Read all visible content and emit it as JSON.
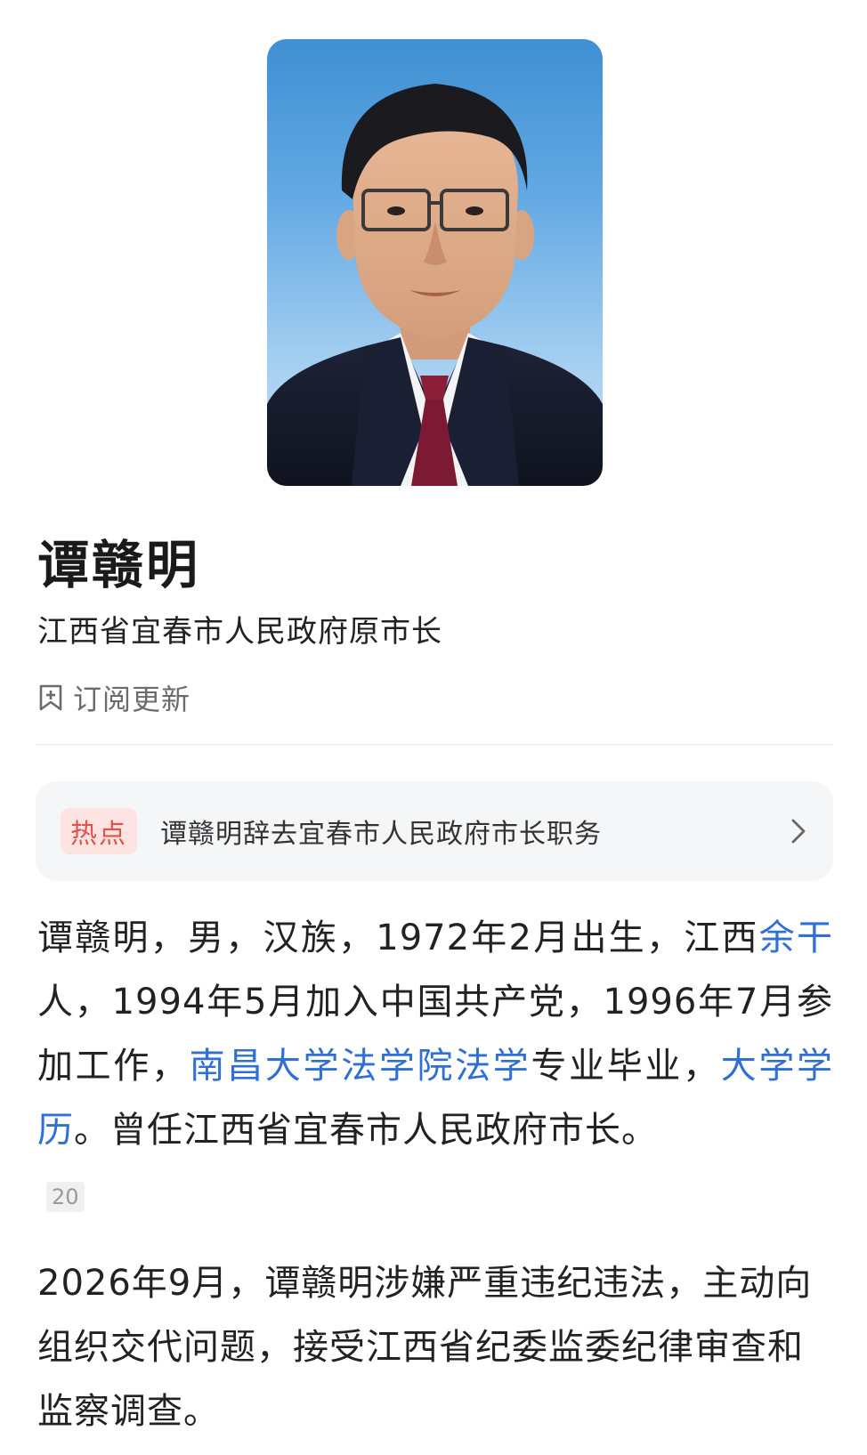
{
  "profile": {
    "name": "谭赣明",
    "position": "江西省宜春市人民政府原市长",
    "subscribe_label": "订阅更新"
  },
  "hot": {
    "badge": "热点",
    "headline": "谭赣明辞去宜春市人民政府市长职务"
  },
  "bio": {
    "p1_part1": "谭赣明，男，汉族，1972年2月出生，江西",
    "p1_link1": "余干",
    "p1_part2": "人，1994年5月加入中国共产党，1996年7月参加工作，",
    "p1_link2": "南昌大学法学院法学",
    "p1_part3": "专业毕业，",
    "p1_link3": "大学学历",
    "p1_part4": "。曾任江西省宜春市人民政府市长。",
    "citation": "20",
    "p2": "2026年9月，谭赣明涉嫌严重违纪违法，主动向组织交代问题，接受江西省纪委监委纪律审查和监察调查。"
  },
  "colors": {
    "link": "#2f6fd6",
    "hot_badge_text": "#e0524a",
    "hot_badge_bg": "#fde3e1",
    "card_bg": "#f5f6f7"
  },
  "icons": {
    "subscribe": "bookmark-plus-icon",
    "chevron": "chevron-right-icon"
  }
}
